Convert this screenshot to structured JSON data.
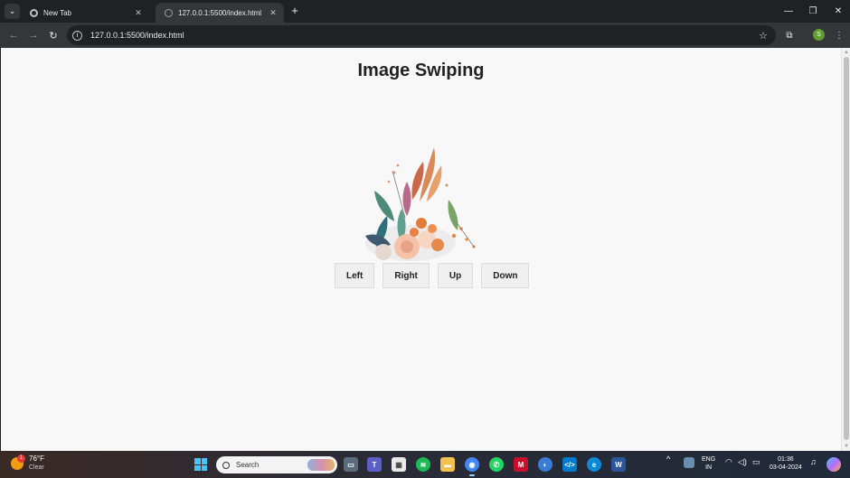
{
  "browser": {
    "tabs": [
      {
        "title": "New Tab",
        "close": "✕"
      },
      {
        "title": "127.0.0.1:5500/index.html",
        "close": "✕"
      }
    ],
    "new_tab": "+",
    "url": "127.0.0.1:5500/index.html",
    "profile_initial": "S"
  },
  "page": {
    "title": "Image Swiping",
    "buttons": {
      "left": "Left",
      "right": "Right",
      "up": "Up",
      "down": "Down"
    }
  },
  "taskbar": {
    "weather": {
      "temp": "76°F",
      "condition": "Clear",
      "badge": "1"
    },
    "search_placeholder": "Search",
    "language": {
      "line1": "ENG",
      "line2": "IN"
    },
    "clock": {
      "time": "01:36",
      "date": "03-04-2024"
    }
  },
  "colors": {
    "accent": "#4cc2ff",
    "page_bg": "#f8f8f8",
    "chrome_dark": "#202124"
  }
}
